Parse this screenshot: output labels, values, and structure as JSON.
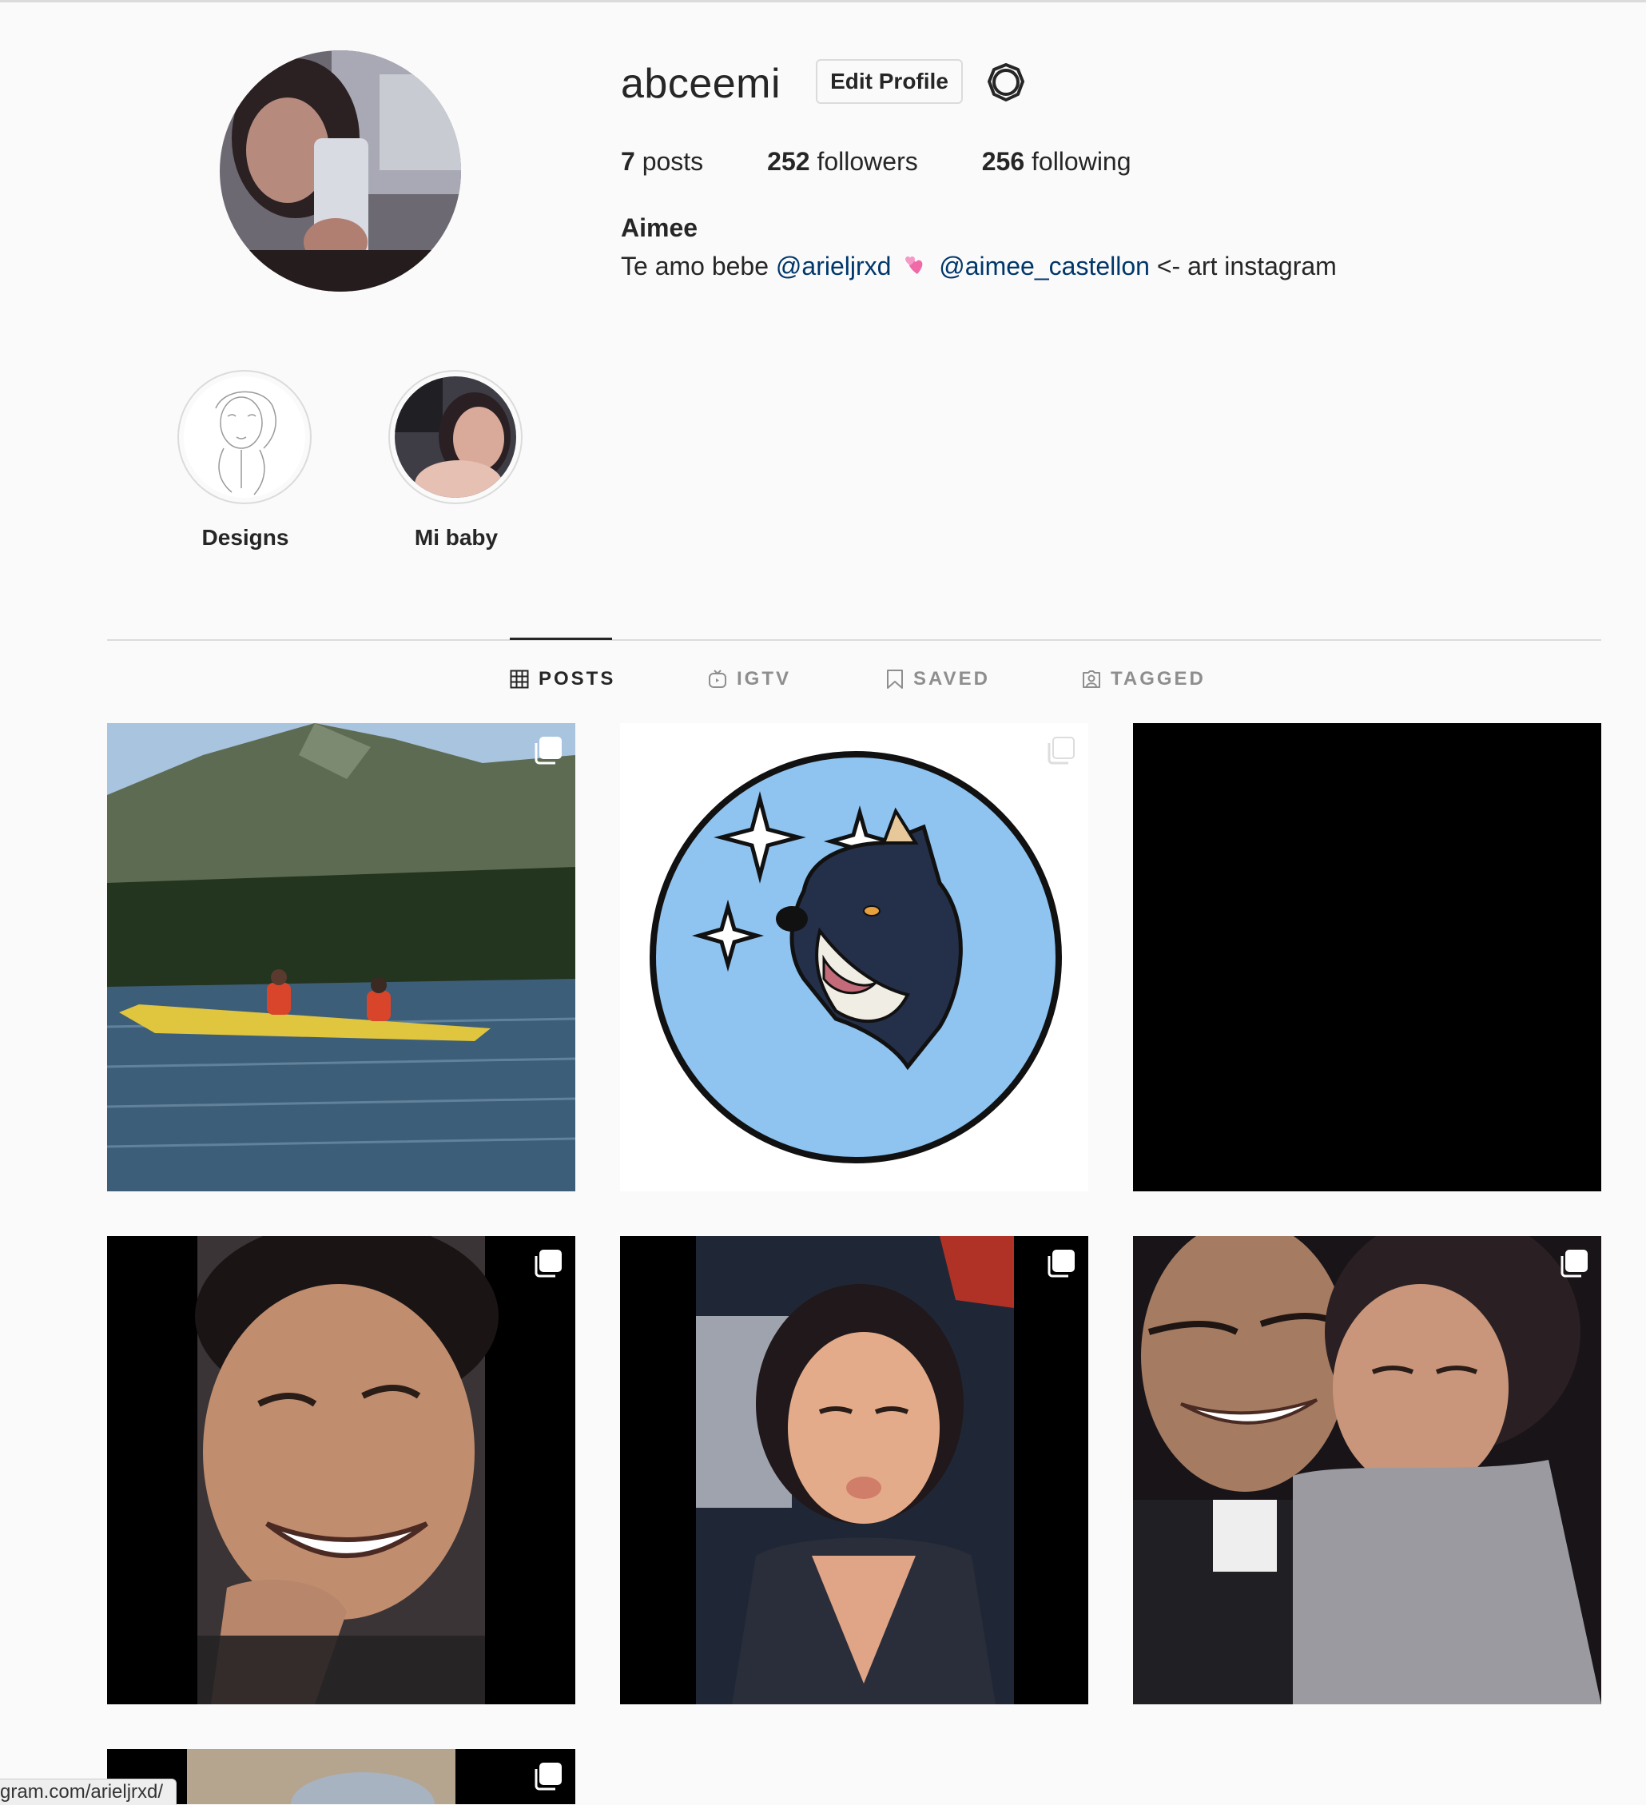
{
  "profile": {
    "username": "abceemi",
    "edit_label": "Edit Profile",
    "settings_icon": "gear-icon",
    "stats": {
      "posts_count": "7",
      "posts_label": "posts",
      "followers_count": "252",
      "followers_label": "followers",
      "following_count": "256",
      "following_label": "following"
    },
    "full_name": "Aimee",
    "bio": {
      "prefix": "Te amo bebe",
      "mention1": "@arieljrxd",
      "emoji": "💕",
      "mention2": "@aimee_castellon",
      "suffix": "<- art instagram"
    }
  },
  "highlights": [
    {
      "label": "Designs"
    },
    {
      "label": "Mi baby"
    }
  ],
  "tabs": [
    {
      "label": "POSTS",
      "icon": "grid-icon",
      "active": true
    },
    {
      "label": "IGTV",
      "icon": "igtv-icon",
      "active": false
    },
    {
      "label": "SAVED",
      "icon": "bookmark-icon",
      "active": false
    },
    {
      "label": "TAGGED",
      "icon": "tagged-icon",
      "active": false
    }
  ],
  "posts": [
    {
      "content": "kayak on lake",
      "multi": true
    },
    {
      "content": "wolf illustration",
      "multi": true
    },
    {
      "content": "black image",
      "multi": false
    },
    {
      "content": "smiling man",
      "multi": true
    },
    {
      "content": "selfie",
      "multi": true
    },
    {
      "content": "couple selfie",
      "multi": true
    },
    {
      "content": "partial photo",
      "multi": true
    }
  ],
  "status_bar": {
    "url": "gram.com/arieljrxd/"
  },
  "colors": {
    "background": "#fafafa",
    "text": "#262626",
    "secondary_text": "#8e8e8e",
    "link": "#00376b",
    "border": "#dbdbdb"
  }
}
